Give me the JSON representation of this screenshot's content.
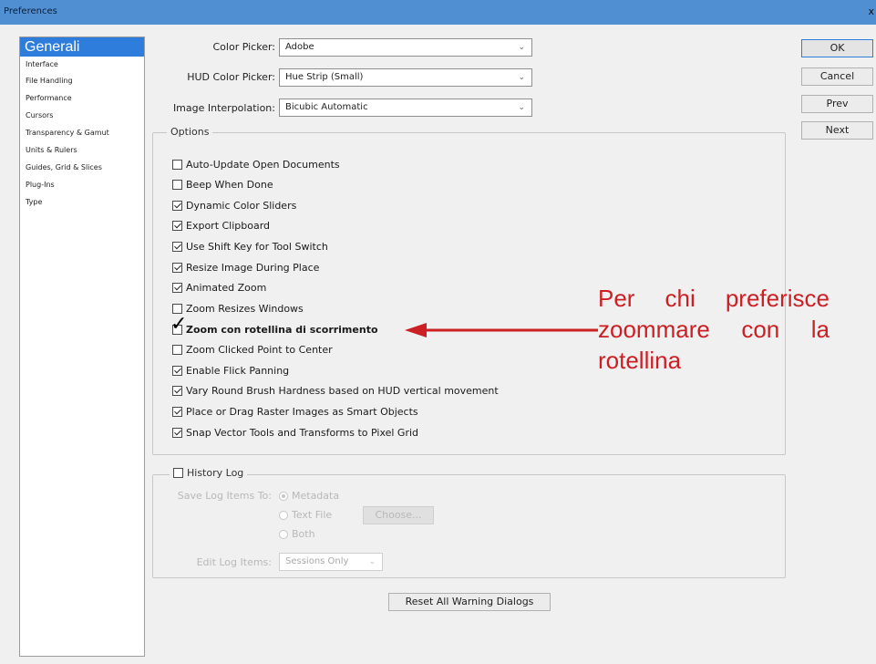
{
  "window": {
    "title": "Preferences",
    "close": "x"
  },
  "sidebar": {
    "items": [
      {
        "label": "Generali",
        "active": true
      },
      {
        "label": "Interface"
      },
      {
        "label": "File Handling"
      },
      {
        "label": "Performance"
      },
      {
        "label": "Cursors"
      },
      {
        "label": "Transparency & Gamut"
      },
      {
        "label": "Units & Rulers"
      },
      {
        "label": "Guides, Grid & Slices"
      },
      {
        "label": "Plug-Ins"
      },
      {
        "label": "Type"
      }
    ]
  },
  "pickers": {
    "color_picker": {
      "label": "Color Picker:",
      "value": "Adobe"
    },
    "hud_color_picker": {
      "label": "HUD Color Picker:",
      "value": "Hue Strip (Small)"
    },
    "image_interpolation": {
      "label": "Image Interpolation:",
      "value": "Bicubic Automatic"
    }
  },
  "options": {
    "legend": "Options",
    "items": [
      {
        "label": "Auto-Update Open Documents",
        "checked": false
      },
      {
        "label": "Beep When Done",
        "checked": false
      },
      {
        "label": "Dynamic Color Sliders",
        "checked": true
      },
      {
        "label": "Export Clipboard",
        "checked": true
      },
      {
        "label": "Use Shift Key for Tool Switch",
        "checked": true
      },
      {
        "label": "Resize Image During Place",
        "checked": true
      },
      {
        "label": "Animated Zoom",
        "checked": true
      },
      {
        "label": "Zoom Resizes Windows",
        "checked": false
      },
      {
        "label": "Zoom con rotellina di scorrimento",
        "checked": true
      },
      {
        "label": "Zoom Clicked Point to Center",
        "checked": false
      },
      {
        "label": "Enable Flick Panning",
        "checked": true
      },
      {
        "label": "Vary Round Brush Hardness based on HUD vertical movement",
        "checked": true
      },
      {
        "label": "Place or Drag Raster Images as Smart Objects",
        "checked": true
      },
      {
        "label": "Snap Vector Tools and Transforms to Pixel Grid",
        "checked": true
      }
    ]
  },
  "history": {
    "legend": "History Log",
    "checked": false,
    "save_label": "Save Log Items To:",
    "radios": [
      {
        "label": "Metadata",
        "selected": true
      },
      {
        "label": "Text File",
        "selected": false
      },
      {
        "label": "Both",
        "selected": false
      }
    ],
    "choose_button": "Choose...",
    "edit_label": "Edit Log Items:",
    "edit_value": "Sessions Only"
  },
  "reset_button": "Reset All Warning Dialogs",
  "buttons": {
    "ok": "OK",
    "cancel": "Cancel",
    "prev": "Prev",
    "next": "Next"
  },
  "annotation": {
    "lines": [
      "Per chi preferisce",
      "zoommare con la",
      "rotellina"
    ],
    "color": "#cc1f24"
  },
  "colors": {
    "accent": "#2e7ddc",
    "titlebar": "#4f8fd2"
  }
}
